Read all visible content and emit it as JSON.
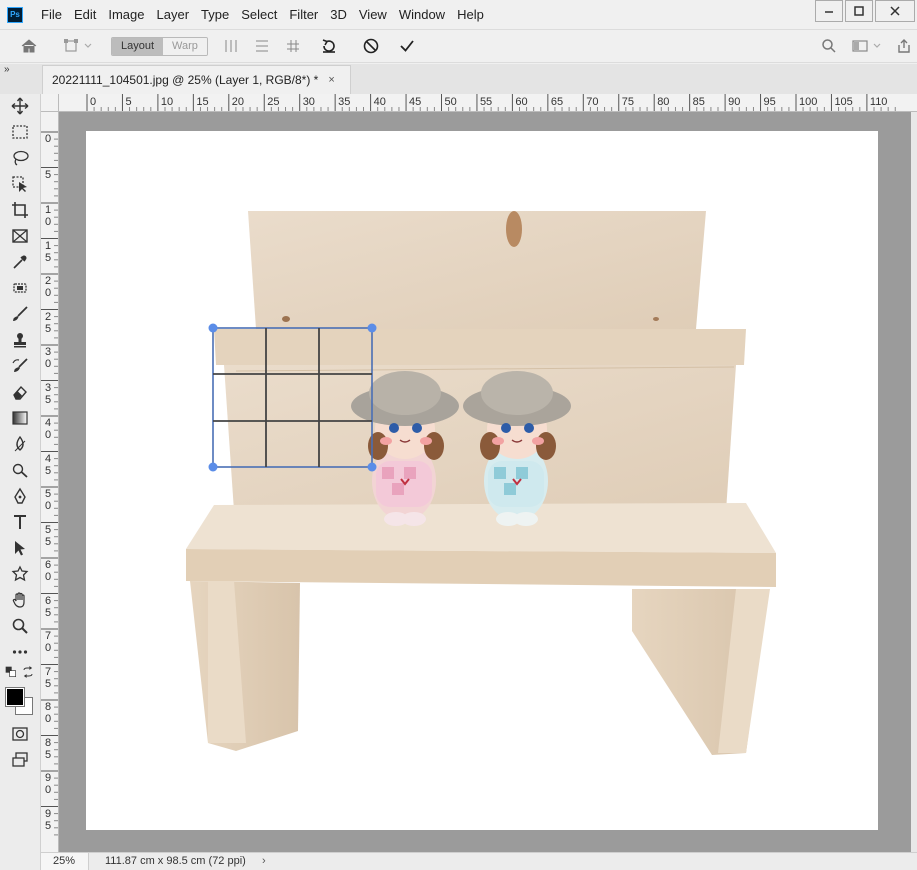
{
  "app": {
    "logo_text": "Ps"
  },
  "menu": [
    "File",
    "Edit",
    "Image",
    "Layer",
    "Type",
    "Select",
    "Filter",
    "3D",
    "View",
    "Window",
    "Help"
  ],
  "options_bar": {
    "mode_layout": "Layout",
    "mode_warp": "Warp"
  },
  "tab": {
    "title": "20221111_104501.jpg @ 25% (Layer 1, RGB/8*) *",
    "close": "×"
  },
  "panel_collapse_glyph": "»",
  "ruler": {
    "top": [
      "0",
      "5",
      "10",
      "15",
      "20",
      "25",
      "30",
      "35",
      "40",
      "45",
      "50",
      "55",
      "60",
      "65",
      "70",
      "75",
      "80",
      "85",
      "90",
      "95",
      "100",
      "105",
      "110"
    ],
    "left": [
      "0",
      "5",
      "10",
      "15",
      "20",
      "25",
      "30",
      "35",
      "40",
      "45",
      "50",
      "55",
      "60",
      "65",
      "70",
      "75",
      "80",
      "85",
      "90",
      "95"
    ]
  },
  "status": {
    "zoom": "25%",
    "doc_info": "111.87 cm x 98.5 cm (72 ppi)",
    "arrow": "›"
  },
  "colors": {
    "foreground": "#000000",
    "background": "#ffffff",
    "accent": "#5b8de8",
    "workspace": "#9b9b9b"
  },
  "icons": {
    "toolbar": [
      "move-icon",
      "marquee-icon",
      "lasso-icon",
      "object-select-icon",
      "crop-icon",
      "frame-icon",
      "eyedropper-icon",
      "healing-icon",
      "brush-icon",
      "stamp-icon",
      "history-brush-icon",
      "eraser-icon",
      "gradient-icon",
      "blur-icon",
      "dodge-icon",
      "pen-icon",
      "type-icon",
      "path-select-icon",
      "shape-icon",
      "hand-icon",
      "zoom-icon",
      "more-tools-icon"
    ]
  }
}
